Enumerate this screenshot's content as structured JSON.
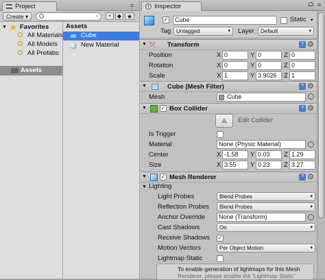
{
  "project": {
    "tab_title": "Project",
    "create_label": "Create ▾",
    "favorites_label": "Favorites",
    "favorites": [
      "All Materials",
      "All Models",
      "All Prefabs"
    ],
    "assets_label": "Assets",
    "assets_header": "Assets",
    "asset_items": [
      {
        "name": "Cube",
        "selected": true
      },
      {
        "name": "New Material",
        "selected": false
      }
    ]
  },
  "inspector": {
    "tab_title": "Inspector",
    "object_name": "Cube",
    "static_label": "Static",
    "tag_label": "Tag",
    "tag_value": "Untagged",
    "layer_label": "Layer",
    "layer_value": "Default",
    "transform": {
      "title": "Transform",
      "position_label": "Position",
      "rotation_label": "Rotation",
      "scale_label": "Scale",
      "x": "X",
      "y": "Y",
      "z": "Z",
      "position": [
        "0",
        "0",
        "0"
      ],
      "rotation": [
        "0",
        "0",
        "0"
      ],
      "scale": [
        "1",
        "3.9026",
        "1"
      ]
    },
    "mesh_filter": {
      "title": "Cube (Mesh Filter)",
      "mesh_label": "Mesh",
      "mesh_value": "Cube"
    },
    "box_collider": {
      "title": "Box Collider",
      "edit_label": "Edit Collider",
      "is_trigger_label": "Is Trigger",
      "material_label": "Material",
      "material_value": "None (Physic Material)",
      "center_label": "Center",
      "center": [
        "-1.58",
        "0.03",
        "1.29"
      ],
      "size_label": "Size",
      "size": [
        "3.55",
        "0.23",
        "3.27"
      ]
    },
    "mesh_renderer": {
      "title": "Mesh Renderer",
      "lighting_label": "Lighting",
      "rows": [
        {
          "label": "Light Probes",
          "value": "Blend Probes",
          "kind": "dd"
        },
        {
          "label": "Reflection Probes",
          "value": "Blend Probes",
          "kind": "dd"
        },
        {
          "label": "Anchor Override",
          "value": "None (Transform)",
          "kind": "obj"
        },
        {
          "label": "Cast Shadows",
          "value": "On",
          "kind": "dd"
        },
        {
          "label": "Receive Shadows",
          "value": "✓",
          "kind": "cb"
        },
        {
          "label": "Motion Vectors",
          "value": "Per Object Motion",
          "kind": "dd"
        },
        {
          "label": "Lightmap Static",
          "value": "",
          "kind": "cb"
        }
      ],
      "info_line1": "To enable generation of lightmaps for this Mesh",
      "info_line2": "Renderer, please enable the 'Lightmap Static'"
    }
  }
}
